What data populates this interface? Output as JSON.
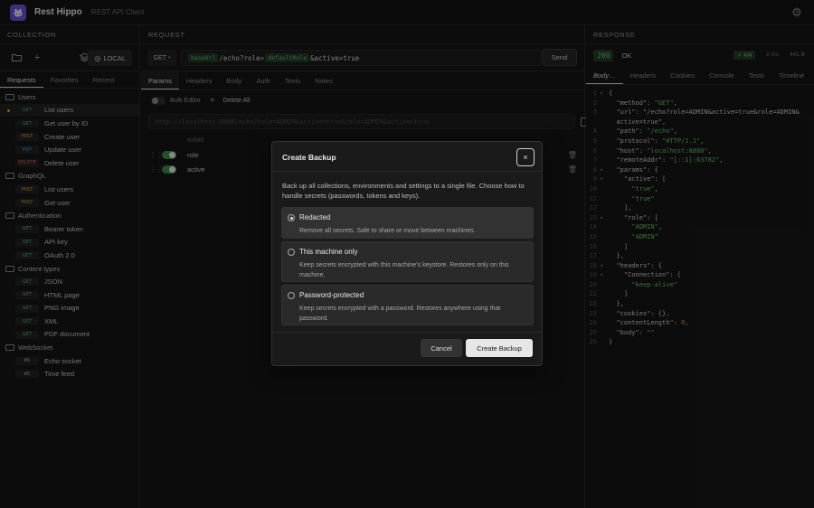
{
  "app": {
    "name": "Rest Hippo",
    "subtitle": "REST API Client"
  },
  "collection": {
    "title": "COLLECTION",
    "env_label": "LOCAL",
    "tabs": [
      "Requests",
      "Favorites",
      "Recent"
    ],
    "folders": [
      {
        "name": "Users",
        "items": [
          {
            "method": "GET",
            "label": "List users",
            "selected": true
          },
          {
            "method": "GET",
            "label": "Get user by ID"
          },
          {
            "method": "POST",
            "label": "Create user"
          },
          {
            "method": "PUT",
            "label": "Update user"
          },
          {
            "method": "DELETE",
            "label": "Delete user"
          }
        ]
      },
      {
        "name": "GraphQL",
        "items": [
          {
            "method": "POST",
            "label": "List users"
          },
          {
            "method": "POST",
            "label": "Get user"
          }
        ]
      },
      {
        "name": "Authentication",
        "items": [
          {
            "method": "GET",
            "label": "Bearer token"
          },
          {
            "method": "GET",
            "label": "API key"
          },
          {
            "method": "GET",
            "label": "OAuth 2.0"
          }
        ]
      },
      {
        "name": "Content types",
        "items": [
          {
            "method": "GET",
            "label": "JSON"
          },
          {
            "method": "GET",
            "label": "HTML page"
          },
          {
            "method": "GET",
            "label": "PNG image"
          },
          {
            "method": "GET",
            "label": "XML"
          },
          {
            "method": "GET",
            "label": "PDF document"
          }
        ]
      },
      {
        "name": "WebSocket",
        "items": [
          {
            "method": "WS",
            "label": "Echo socket"
          },
          {
            "method": "WS",
            "label": "Time feed"
          }
        ]
      }
    ]
  },
  "request": {
    "title": "REQUEST",
    "method": "GET",
    "url_var1": "baseUrl",
    "url_mid": "/echo?role=",
    "url_var2": "defaultRole",
    "url_end": "&active=true",
    "send_label": "Send",
    "tabs": [
      "Params",
      "Headers",
      "Body",
      "Auth",
      "Tests",
      "Notes"
    ],
    "bulk_editor_label": "Bulk Editor",
    "delete_all_label": "Delete All",
    "preview_url": "http://localhost:8888/echo?role=ADMIN&active=true&role=ADMIN&active=true",
    "name_header": "NAME",
    "params": [
      "role",
      "active"
    ]
  },
  "response": {
    "title": "RESPONSE",
    "status_code": "200",
    "status_text": "OK",
    "tests_passed": "✓ 4/4",
    "time": "2 ms",
    "size": "441 B",
    "tabs": [
      "Body…",
      "Headers",
      "Cookies",
      "Console",
      "Tests",
      "Timeline"
    ],
    "lines": [
      {
        "n": "1",
        "f": "▾",
        "t": "{"
      },
      {
        "n": "2",
        "f": "",
        "t": "  \"method\": \"GET\","
      },
      {
        "n": "3",
        "f": "",
        "t": "  \"url\": \"/echo?role=ADMIN&active=true&role=ADMIN&"
      },
      {
        "n": "",
        "f": "",
        "t": "  active=true\","
      },
      {
        "n": "4",
        "f": "",
        "t": "  \"path\": \"/echo\","
      },
      {
        "n": "5",
        "f": "",
        "t": "  \"protocol\": \"HTTP/1.1\","
      },
      {
        "n": "6",
        "f": "",
        "t": "  \"host\": \"localhost:8888\","
      },
      {
        "n": "7",
        "f": "",
        "t": "  \"remoteAddr\": \"[::1]:63782\","
      },
      {
        "n": "8",
        "f": "▾",
        "t": "  \"params\": {"
      },
      {
        "n": "9",
        "f": "▾",
        "t": "    \"active\": ["
      },
      {
        "n": "10",
        "f": "",
        "t": "      \"true\","
      },
      {
        "n": "11",
        "f": "",
        "t": "      \"true\""
      },
      {
        "n": "12",
        "f": "",
        "t": "    ],"
      },
      {
        "n": "13",
        "f": "▾",
        "t": "    \"role\": ["
      },
      {
        "n": "14",
        "f": "",
        "t": "      \"ADMIN\","
      },
      {
        "n": "15",
        "f": "",
        "t": "      \"ADMIN\""
      },
      {
        "n": "16",
        "f": "",
        "t": "    ]"
      },
      {
        "n": "17",
        "f": "",
        "t": "  },"
      },
      {
        "n": "18",
        "f": "▾",
        "t": "  \"headers\": {"
      },
      {
        "n": "19",
        "f": "▾",
        "t": "    \"Connection\": ["
      },
      {
        "n": "20",
        "f": "",
        "t": "      \"keep-alive\""
      },
      {
        "n": "21",
        "f": "",
        "t": "    ]"
      },
      {
        "n": "22",
        "f": "",
        "t": "  },"
      },
      {
        "n": "23",
        "f": "",
        "t": "  \"cookies\": {},"
      },
      {
        "n": "24",
        "f": "",
        "t": "  \"contentLength\": 0,"
      },
      {
        "n": "25",
        "f": "",
        "t": "  \"body\": \"\""
      },
      {
        "n": "26",
        "f": "",
        "t": "}"
      }
    ]
  },
  "modal": {
    "title": "Create Backup",
    "close_label": "×",
    "description": "Back up all collections, environments and settings to a single file. Choose how to handle secrets (passwords, tokens and keys).",
    "options": [
      {
        "title": "Redacted",
        "desc": "Remove all secrets. Safe to share or move between machines.",
        "selected": true
      },
      {
        "title": "This machine only",
        "desc": "Keep secrets encrypted with this machine's keystore. Restores only on this machine.",
        "selected": false
      },
      {
        "title": "Password-protected",
        "desc": "Keep secrets encrypted with a password. Restores anywhere using that password.",
        "selected": false
      }
    ],
    "cancel_label": "Cancel",
    "confirm_label": "Create Backup"
  }
}
